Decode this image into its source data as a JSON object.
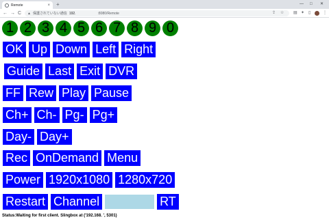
{
  "browser": {
    "tab_title": "Remote",
    "tab_close": "×",
    "new_tab": "+",
    "win_min": "—",
    "win_max": "□",
    "win_close": "✕",
    "back": "←",
    "forward": "→",
    "reload": "C",
    "security_warning": "▲",
    "security_text": "保護されていない通信",
    "host": "192.",
    "path": ":8080/Remote",
    "toolbar_icons": [
      "share-icon",
      "bookmark-star-icon",
      "extension-icon",
      "puzzle-icon",
      "sidebar-icon"
    ],
    "icon_glyphs": [
      "⇪",
      "☆",
      "▤",
      "✦",
      "▯",
      "⋮"
    ]
  },
  "remote": {
    "number_buttons": [
      "1",
      "2",
      "3",
      "4",
      "5",
      "6",
      "7",
      "8",
      "9",
      "0"
    ],
    "rows": [
      [
        "OK",
        "Up",
        "Down",
        "Left",
        "Right"
      ],
      [
        "Guide",
        "Last",
        "Exit",
        "DVR"
      ],
      [
        "FF",
        "Rew",
        "Play",
        "Pause"
      ],
      [
        "Ch+",
        "Ch-",
        "Pg-",
        "Pg+"
      ],
      [
        "Day-",
        "Day+"
      ],
      [
        "Rec",
        "OnDemand",
        "Menu"
      ],
      [
        "Power",
        "1920x1080",
        "1280x720"
      ],
      [
        "Restart",
        "Channel"
      ]
    ],
    "channel_input_value": "",
    "rt_label": "RT"
  },
  "status": {
    "text": "Status:Waiting for first client. Slingbox at ('192.168.        ', 5301)"
  },
  "colors": {
    "button_bg": "#0000ff",
    "button_text": "#ffffff",
    "number_bg": "#008000",
    "channel_input_bg": "#add8e6"
  }
}
